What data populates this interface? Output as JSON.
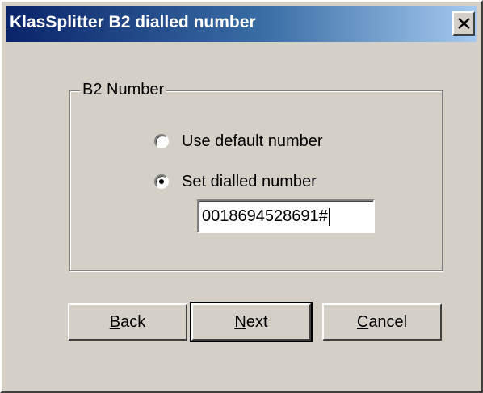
{
  "window": {
    "title": "KlasSplitter B2 dialled number",
    "close_label": "×"
  },
  "group": {
    "label": "B2 Number"
  },
  "options": {
    "default_label": "Use default number",
    "default_checked": false,
    "set_label": "Set dialled number",
    "set_checked": true
  },
  "number_field": {
    "value": "0018694528691#"
  },
  "buttons": {
    "back_mnemonic": "B",
    "back_rest": "ack",
    "next_mnemonic": "N",
    "next_rest": "ext",
    "cancel_mnemonic": "C",
    "cancel_rest": "ancel"
  },
  "icons": {
    "close": "close-icon"
  }
}
